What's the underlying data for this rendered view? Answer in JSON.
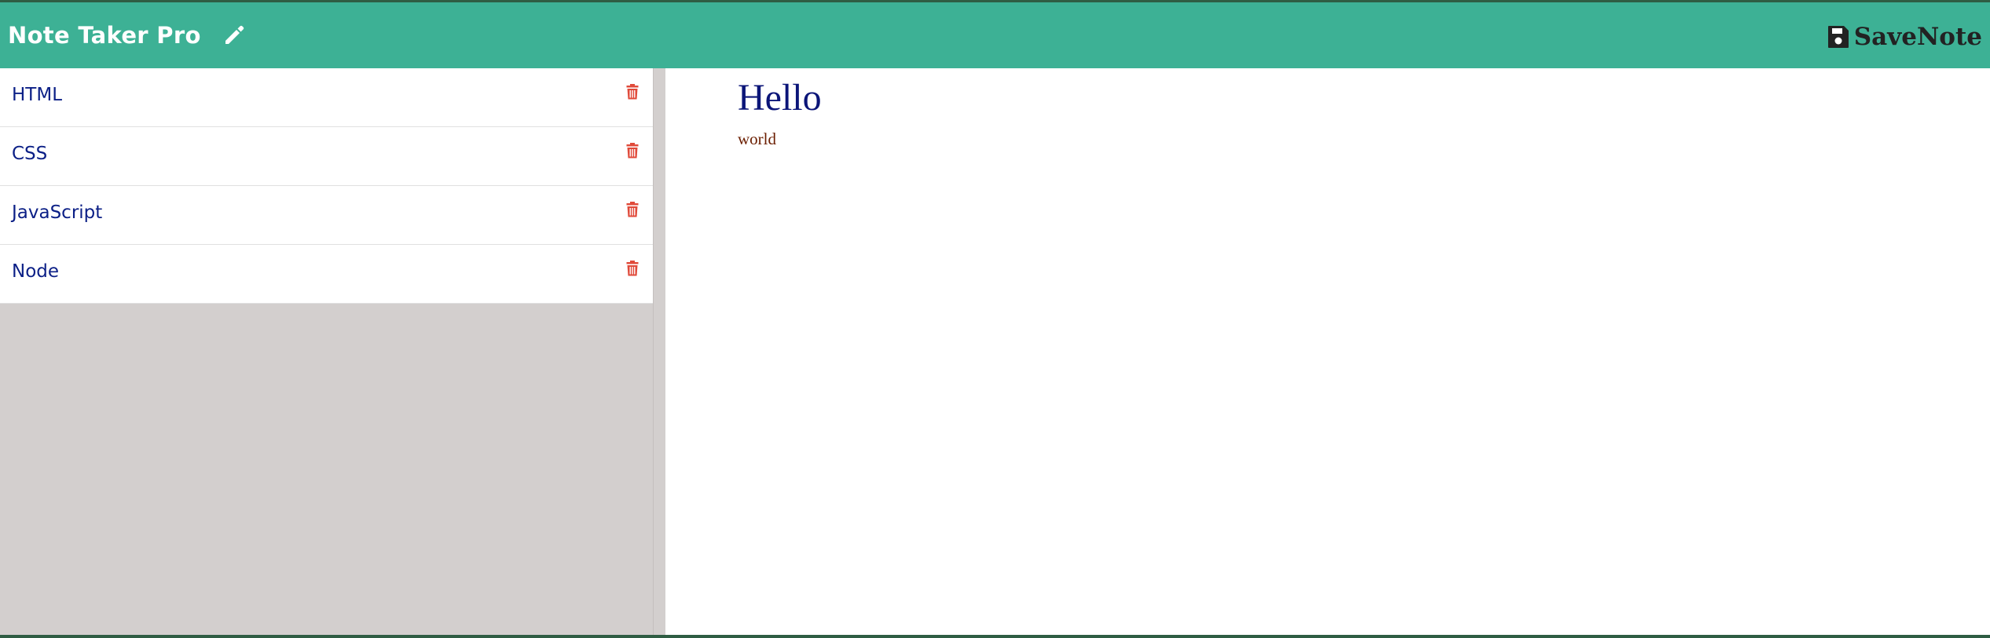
{
  "header": {
    "title": "Note Taker Pro",
    "edit_icon": "pencil-icon",
    "save_label": "SaveNote",
    "save_icon": "floppy-disk-icon"
  },
  "notes": [
    {
      "title": "HTML"
    },
    {
      "title": "CSS"
    },
    {
      "title": "JavaScript"
    },
    {
      "title": "Node"
    }
  ],
  "delete_icon": "trash-icon",
  "active_note": {
    "title": "Hello",
    "text": "world"
  },
  "colors": {
    "navbar": "#3db195",
    "sidebar": "#d3cfce",
    "note_title": "#0b1f86",
    "delete_icon": "#e04a3a",
    "heading": "#0b1578",
    "body_text": "#6b1e00"
  }
}
